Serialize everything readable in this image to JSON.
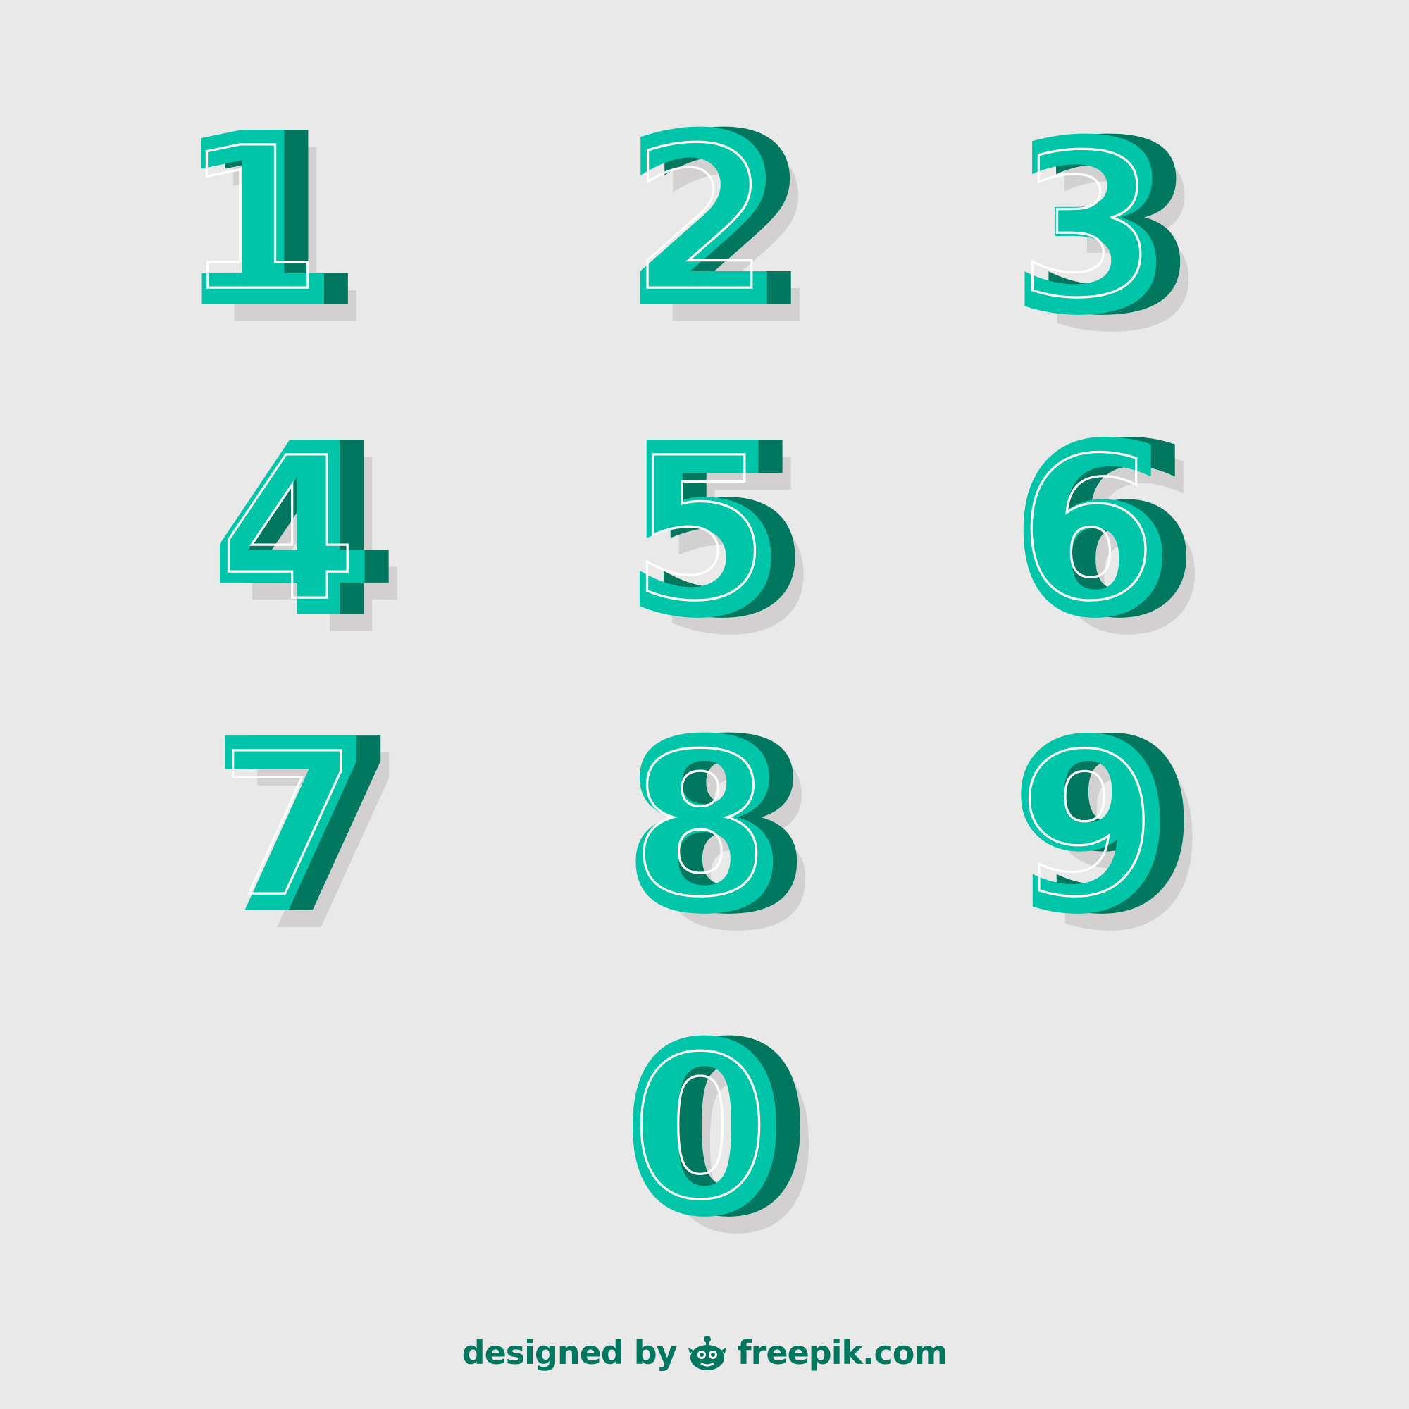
{
  "digits": [
    {
      "id": "1",
      "text": "1"
    },
    {
      "id": "2",
      "text": "2"
    },
    {
      "id": "3",
      "text": "3"
    },
    {
      "id": "4",
      "text": "4"
    },
    {
      "id": "5",
      "text": "5"
    },
    {
      "id": "6",
      "text": "6"
    },
    {
      "id": "7",
      "text": "7"
    },
    {
      "id": "8",
      "text": "8"
    },
    {
      "id": "9",
      "text": "9"
    },
    {
      "id": "0",
      "text": "0"
    }
  ],
  "colors": {
    "background": "#e9e9e9",
    "face": "#00c5a8",
    "depth": "#00775e",
    "shadow": "#d2d0d1",
    "outline": "#ffffff"
  },
  "credit": {
    "prefix": "designed by",
    "logo_icon": "freepik-logo-icon",
    "site": "freepik.com"
  }
}
